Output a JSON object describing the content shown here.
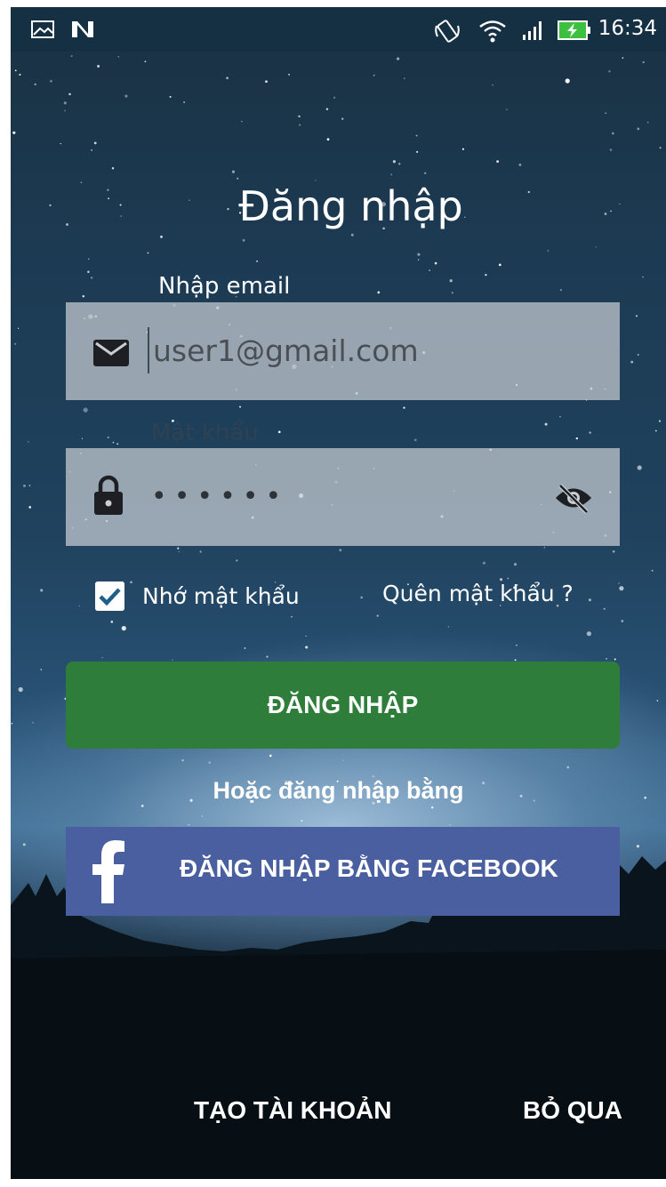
{
  "status_bar": {
    "time": "16:34",
    "left_icons": [
      "image-icon",
      "n-notification-icon"
    ],
    "right_icons": [
      "vibrate-icon",
      "wifi-icon",
      "signal-icon",
      "battery-charging-icon"
    ]
  },
  "login": {
    "title": "Đăng nhập",
    "email_label": "Nhập email",
    "email_value": "user1@gmail.com",
    "password_label": "Mật khẩu",
    "password_value": "••••••",
    "remember_label": "Nhớ mật khẩu",
    "remember_checked": true,
    "forgot_label": "Quên mật khẩu ?",
    "login_button": "ĐĂNG NHẬP",
    "or_label": "Hoặc đăng nhập bằng",
    "facebook_button": "ĐĂNG NHẬP BẰNG FACEBOOK",
    "create_account": "TẠO TÀI KHOẢN",
    "skip": "BỎ QUA"
  },
  "colors": {
    "login_button": "#2e7d3a",
    "facebook_button": "#4a5fa0",
    "status_bar": "#163043",
    "battery": "#3fbf3f"
  }
}
